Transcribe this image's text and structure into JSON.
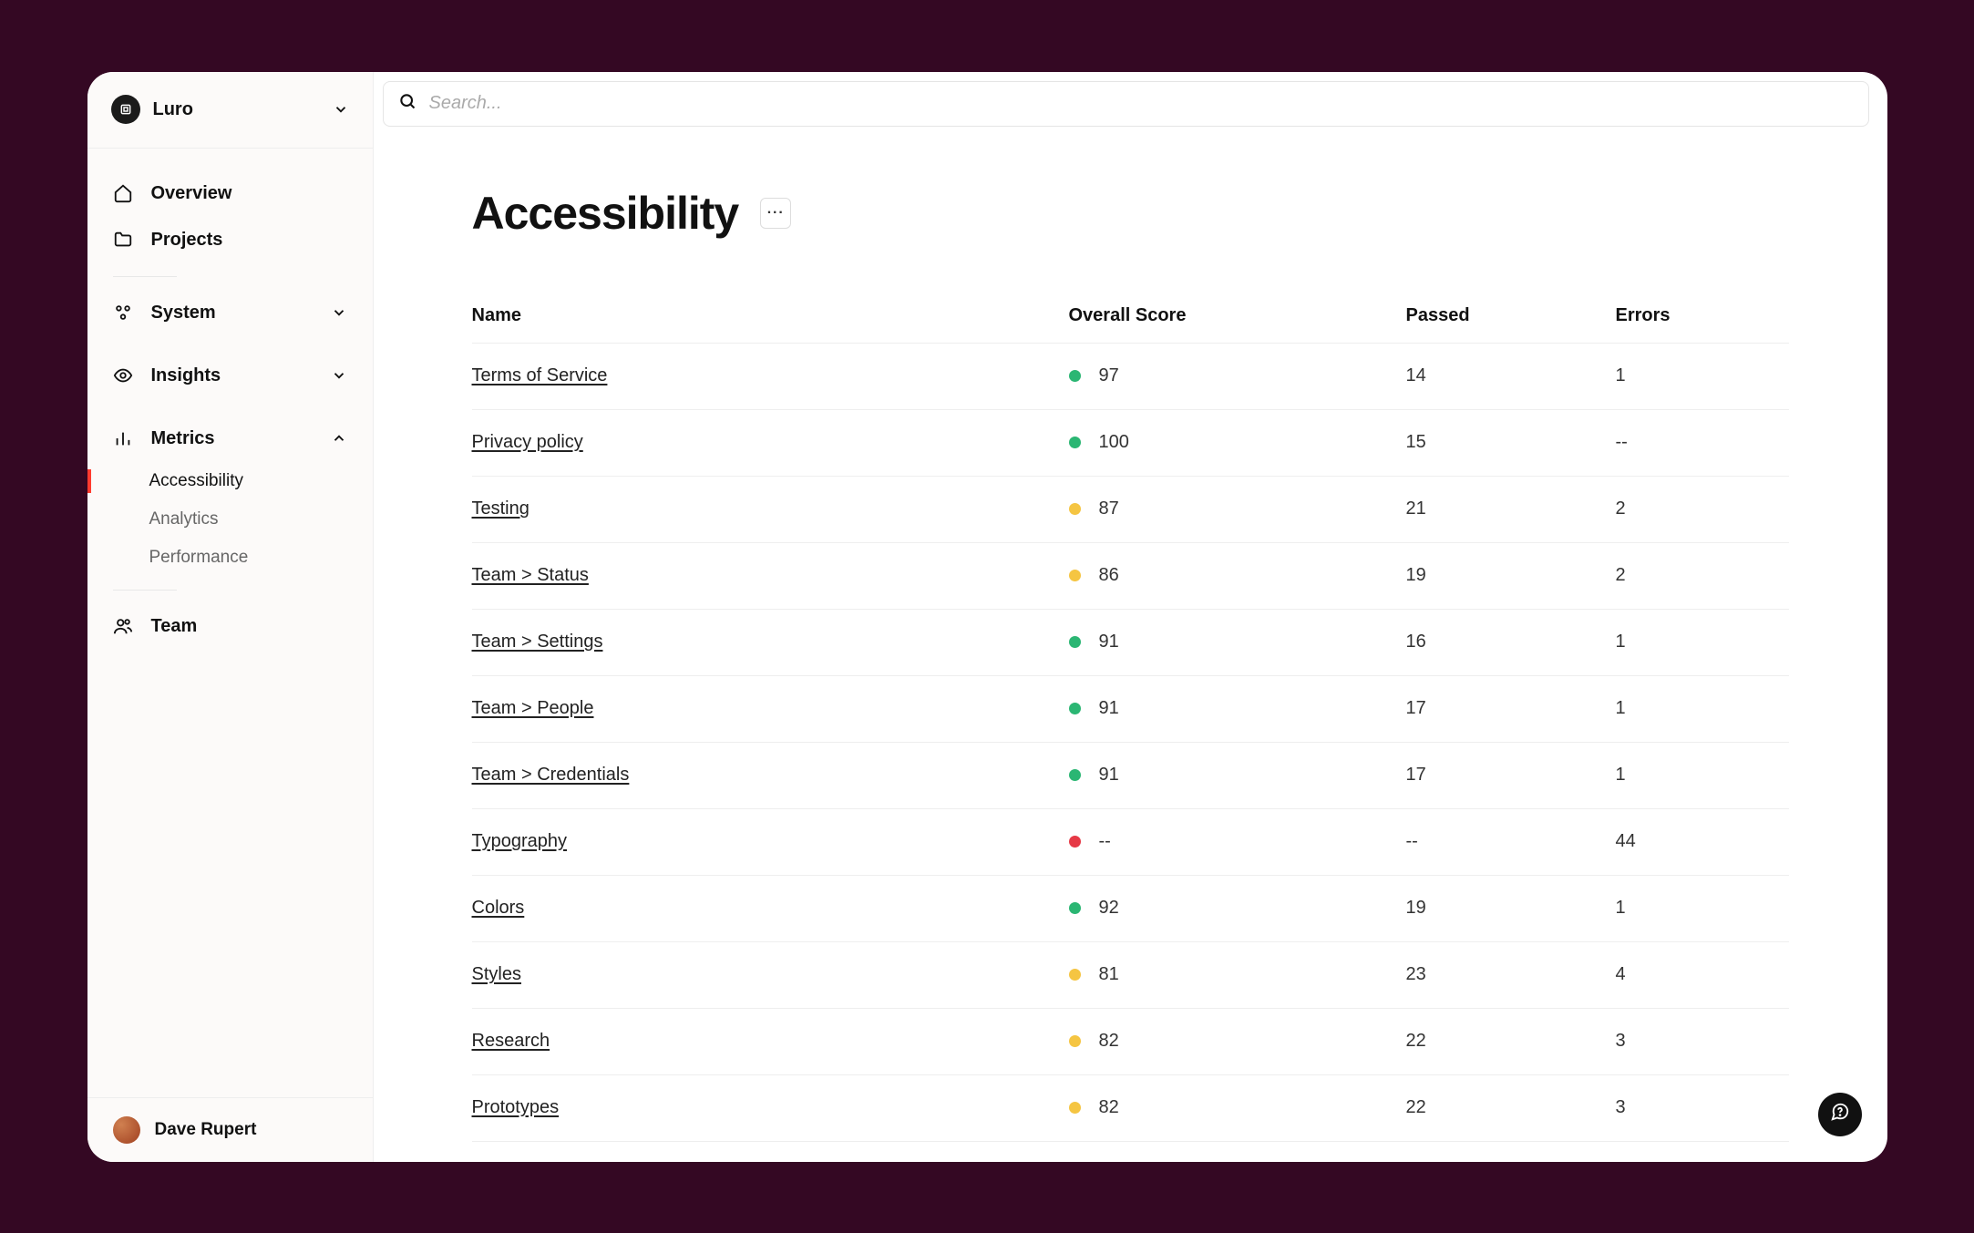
{
  "workspace": {
    "name": "Luro"
  },
  "sidebar": {
    "overview": "Overview",
    "projects": "Projects",
    "system": "System",
    "insights": "Insights",
    "metrics": "Metrics",
    "metrics_children": {
      "accessibility": "Accessibility",
      "analytics": "Analytics",
      "performance": "Performance"
    },
    "team": "Team"
  },
  "user": {
    "name": "Dave Rupert"
  },
  "search": {
    "placeholder": "Search..."
  },
  "page": {
    "title": "Accessibility"
  },
  "table": {
    "headers": {
      "name": "Name",
      "score": "Overall Score",
      "passed": "Passed",
      "errors": "Errors"
    },
    "rows": [
      {
        "name": "Terms of Service",
        "status": "green",
        "score": "97",
        "passed": "14",
        "errors": "1"
      },
      {
        "name": "Privacy policy",
        "status": "green",
        "score": "100",
        "passed": "15",
        "errors": "--"
      },
      {
        "name": "Testing",
        "status": "yellow",
        "score": "87",
        "passed": "21",
        "errors": "2"
      },
      {
        "name": "Team > Status",
        "status": "yellow",
        "score": "86",
        "passed": "19",
        "errors": "2"
      },
      {
        "name": "Team > Settings",
        "status": "green",
        "score": "91",
        "passed": "16",
        "errors": "1"
      },
      {
        "name": "Team > People",
        "status": "green",
        "score": "91",
        "passed": "17",
        "errors": "1"
      },
      {
        "name": "Team > Credentials",
        "status": "green",
        "score": "91",
        "passed": "17",
        "errors": "1"
      },
      {
        "name": "Typography",
        "status": "red",
        "score": "--",
        "passed": "--",
        "errors": "44"
      },
      {
        "name": "Colors",
        "status": "green",
        "score": "92",
        "passed": "19",
        "errors": "1"
      },
      {
        "name": "Styles",
        "status": "yellow",
        "score": "81",
        "passed": "23",
        "errors": "4"
      },
      {
        "name": "Research",
        "status": "yellow",
        "score": "82",
        "passed": "22",
        "errors": "3"
      },
      {
        "name": "Prototypes",
        "status": "yellow",
        "score": "82",
        "passed": "22",
        "errors": "3"
      }
    ]
  }
}
